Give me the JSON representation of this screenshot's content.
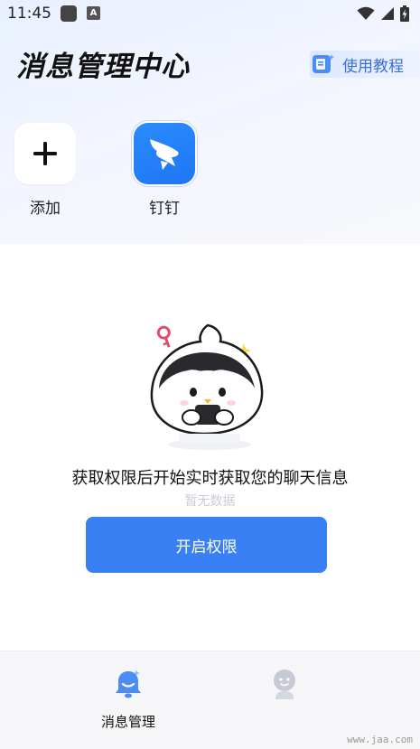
{
  "status_bar": {
    "time": "11:45",
    "notification_app_icon": "A"
  },
  "header": {
    "title": "消息管理中心",
    "tutorial_label": "使用教程"
  },
  "apps": [
    {
      "label": "添加",
      "icon": "plus-icon"
    },
    {
      "label": "钉钉",
      "icon": "dingtalk-icon"
    }
  ],
  "empty_state": {
    "title": "获取权限后开始实时获取您的聊天信息",
    "subtitle": "暂无数据",
    "button_label": "开启权限"
  },
  "bottom_nav": {
    "items": [
      {
        "label": "消息管理",
        "icon": "bell-icon",
        "active": true
      },
      {
        "label": "",
        "icon": "profile-icon",
        "active": false
      }
    ]
  },
  "watermark": "www.jaa.com",
  "colors": {
    "accent": "#3a80f5",
    "tutorial_text": "#3a6fd8",
    "dingtalk": "#1f75f2",
    "subtitle": "#c9ccd3"
  }
}
